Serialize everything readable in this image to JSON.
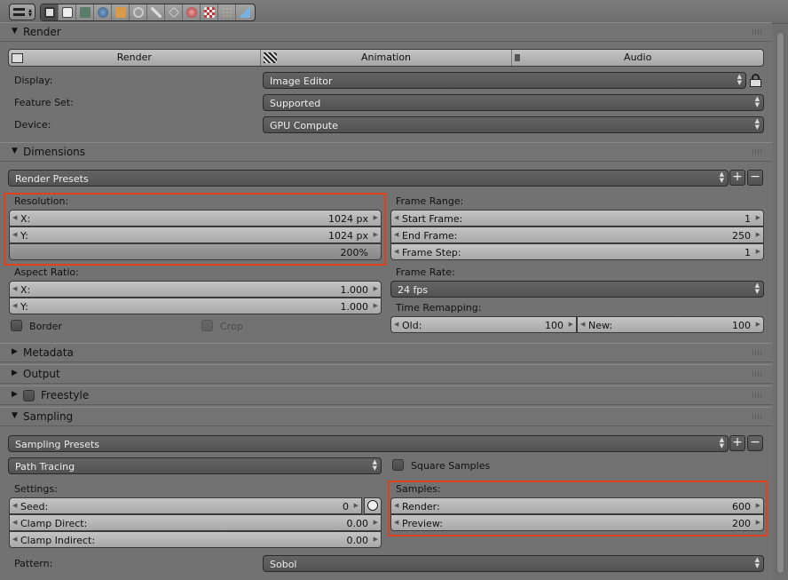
{
  "header": {
    "editor_type_icon": "properties-editor-icon",
    "tabs": [
      {
        "icon": "render-camera-icon",
        "active": true
      },
      {
        "icon": "render-layers-icon"
      },
      {
        "icon": "scene-icon"
      },
      {
        "icon": "world-icon"
      },
      {
        "icon": "object-icon"
      },
      {
        "icon": "constraints-icon"
      },
      {
        "icon": "modifiers-wrench-icon"
      },
      {
        "icon": "vertex-data-icon"
      },
      {
        "icon": "material-icon"
      },
      {
        "icon": "texture-icon"
      },
      {
        "icon": "particles-icon"
      },
      {
        "icon": "physics-icon"
      }
    ]
  },
  "render": {
    "title": "Render",
    "buttons": {
      "render": "Render",
      "animation": "Animation",
      "audio": "Audio"
    },
    "display_label": "Display:",
    "display_value": "Image Editor",
    "feature_set_label": "Feature Set:",
    "feature_set_value": "Supported",
    "device_label": "Device:",
    "device_value": "GPU Compute"
  },
  "dimensions": {
    "title": "Dimensions",
    "presets": "Render Presets",
    "resolution_label": "Resolution:",
    "res_x_key": "X:",
    "res_x_value": "1024 px",
    "res_y_key": "Y:",
    "res_y_value": "1024 px",
    "res_percent": "200%",
    "aspect_label": "Aspect Ratio:",
    "aspect_x_key": "X:",
    "aspect_x_value": "1.000",
    "aspect_y_key": "Y:",
    "aspect_y_value": "1.000",
    "border_label": "Border",
    "crop_label": "Crop",
    "frame_range_label": "Frame Range:",
    "start_key": "Start Frame:",
    "start_value": "1",
    "end_key": "End Frame:",
    "end_value": "250",
    "step_key": "Frame Step:",
    "step_value": "1",
    "frame_rate_label": "Frame Rate:",
    "frame_rate_value": "24 fps",
    "time_remap_label": "Time Remapping:",
    "old_key": "Old:",
    "old_value": "100",
    "new_key": "New:",
    "new_value": "100"
  },
  "collapsed_panels": {
    "metadata": "Metadata",
    "output": "Output",
    "freestyle": "Freestyle"
  },
  "sampling": {
    "title": "Sampling",
    "presets": "Sampling Presets",
    "integrator": "Path Tracing",
    "square_samples_label": "Square Samples",
    "settings_label": "Settings:",
    "seed_key": "Seed:",
    "seed_value": "0",
    "clamp_direct_key": "Clamp Direct:",
    "clamp_direct_value": "0.00",
    "clamp_indirect_key": "Clamp Indirect:",
    "clamp_indirect_value": "0.00",
    "samples_label": "Samples:",
    "render_key": "Render:",
    "render_value": "600",
    "preview_key": "Preview:",
    "preview_value": "200",
    "pattern_label": "Pattern:",
    "pattern_value": "Sobol"
  },
  "highlight_color": "#e0401a"
}
